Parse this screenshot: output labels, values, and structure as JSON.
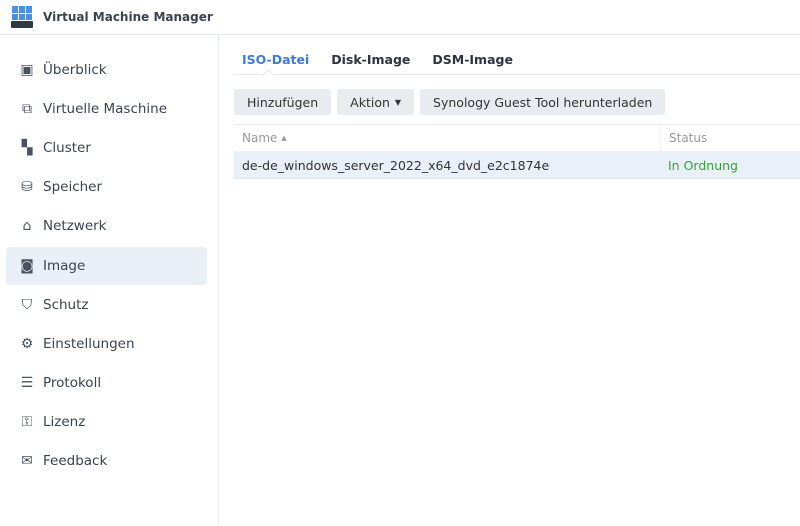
{
  "app": {
    "title": "Virtual Machine Manager"
  },
  "sidebar": {
    "items": [
      {
        "label": "Überblick",
        "icon": "overview-icon"
      },
      {
        "label": "Virtuelle Maschine",
        "icon": "vm-icon"
      },
      {
        "label": "Cluster",
        "icon": "cluster-icon"
      },
      {
        "label": "Speicher",
        "icon": "storage-icon"
      },
      {
        "label": "Netzwerk",
        "icon": "network-icon"
      },
      {
        "label": "Image",
        "icon": "image-icon"
      },
      {
        "label": "Schutz",
        "icon": "shield-icon"
      },
      {
        "label": "Einstellungen",
        "icon": "gear-icon"
      },
      {
        "label": "Protokoll",
        "icon": "log-icon"
      },
      {
        "label": "Lizenz",
        "icon": "key-icon"
      },
      {
        "label": "Feedback",
        "icon": "mail-icon"
      }
    ],
    "active": "Image"
  },
  "tabs": [
    "ISO-Datei",
    "Disk-Image",
    "DSM-Image"
  ],
  "toolbar": {
    "add": "Hinzufügen",
    "action": "Aktion",
    "download": "Synology Guest Tool herunterladen"
  },
  "table": {
    "columns": [
      "Name",
      "Status"
    ],
    "rows": [
      {
        "name": "de-de_windows_server_2022_x64_dvd_e2c1874e",
        "status": "In Ordnung"
      }
    ]
  },
  "colors": {
    "accent": "#3f7bd2",
    "ok": "#3aa03a"
  }
}
